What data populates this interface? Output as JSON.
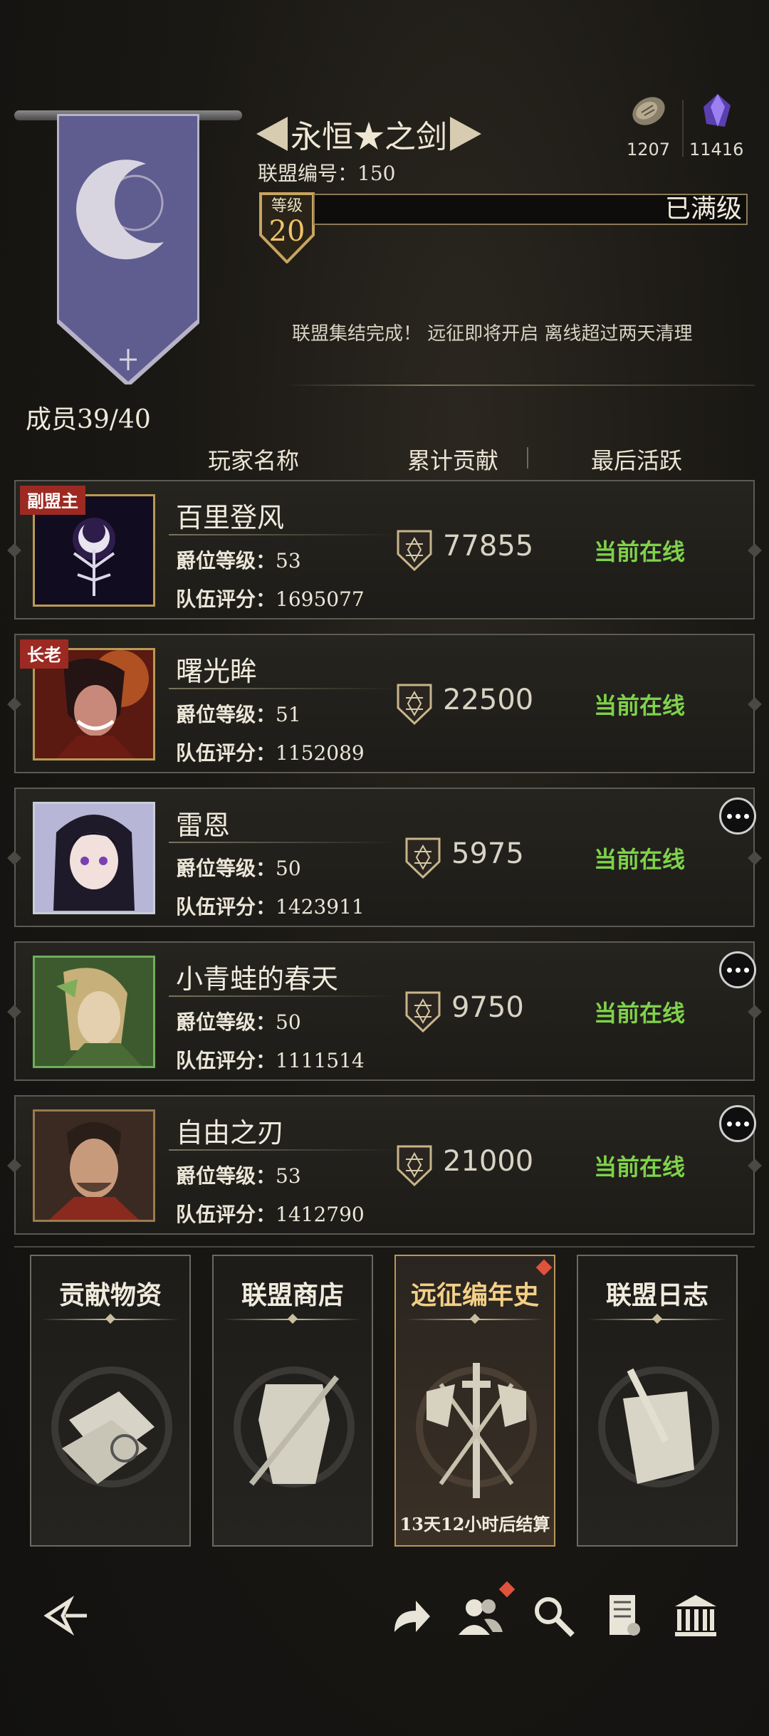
{
  "header": {
    "alliance_name": "永恒★之剑",
    "alliance_id": "联盟编号：150",
    "level_label": "等级",
    "level": "20",
    "level_status": "已满级",
    "notice": "联盟集结完成！ 远征即将开启 离线超过两天清理"
  },
  "resources": [
    {
      "icon": "rune-stone-icon",
      "value": "1207"
    },
    {
      "icon": "purple-crystal-icon",
      "value": "11416"
    }
  ],
  "members": {
    "count": "成员39/40",
    "columns": {
      "name": "玩家名称",
      "contribution": "累计贡献",
      "last_active": "最后活跃"
    },
    "level_key": "爵位等级：",
    "score_key": "队伍评分：",
    "rows": [
      {
        "role": "副盟主",
        "name": "百里登风",
        "level": "53",
        "score": "1695077",
        "contribution": "77855",
        "status": "当前在线",
        "frame": "gold"
      },
      {
        "role": "长老",
        "name": "曙光眸",
        "level": "51",
        "score": "1152089",
        "contribution": "22500",
        "status": "当前在线",
        "frame": "gold"
      },
      {
        "role": "",
        "name": "雷恩",
        "level": "50",
        "score": "1423911",
        "contribution": "5975",
        "status": "当前在线",
        "frame": "silver"
      },
      {
        "role": "",
        "name": "小青蛙的春天",
        "level": "50",
        "score": "1111514",
        "contribution": "9750",
        "status": "当前在线",
        "frame": "green"
      },
      {
        "role": "",
        "name": "自由之刃",
        "level": "53",
        "score": "1412790",
        "contribution": "21000",
        "status": "当前在线",
        "frame": "bronze"
      }
    ]
  },
  "cards": [
    {
      "title": "贡献物资",
      "icon": "supply-scroll-icon",
      "sub": ""
    },
    {
      "title": "联盟商店",
      "icon": "armor-shop-icon",
      "sub": ""
    },
    {
      "title": "远征编年史",
      "icon": "crossed-banners-sword-icon",
      "sub": "13天12小时后结算"
    },
    {
      "title": "联盟日志",
      "icon": "quill-parchment-icon",
      "sub": ""
    }
  ],
  "bottom_bar": [
    "back-icon",
    "share-icon",
    "members-icon",
    "search-icon",
    "document-icon",
    "hall-icon"
  ]
}
